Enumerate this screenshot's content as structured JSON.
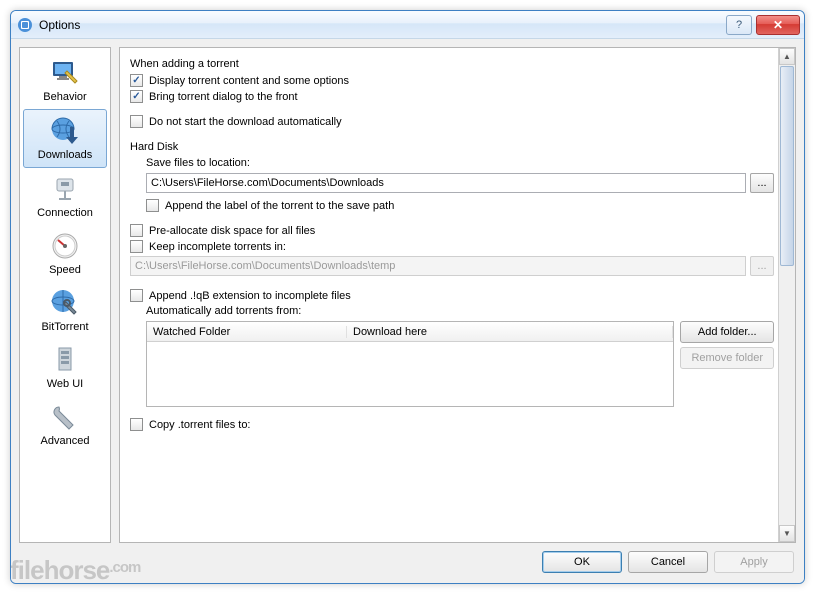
{
  "window": {
    "title": "Options",
    "help_symbol": "?",
    "close_symbol": "✕"
  },
  "sidebar": {
    "items": [
      {
        "label": "Behavior",
        "icon": "monitor-wrench-icon",
        "selected": false
      },
      {
        "label": "Downloads",
        "icon": "globe-download-icon",
        "selected": true
      },
      {
        "label": "Connection",
        "icon": "network-plug-icon",
        "selected": false
      },
      {
        "label": "Speed",
        "icon": "gauge-icon",
        "selected": false
      },
      {
        "label": "BitTorrent",
        "icon": "globe-wrench-icon",
        "selected": false
      },
      {
        "label": "Web UI",
        "icon": "server-rack-icon",
        "selected": false
      },
      {
        "label": "Advanced",
        "icon": "wrench-icon",
        "selected": false
      }
    ]
  },
  "content": {
    "group_add": {
      "header": "When adding a torrent",
      "display_content": {
        "label": "Display torrent content and some options",
        "checked": true
      },
      "bring_front": {
        "label": "Bring torrent dialog to the front",
        "checked": true
      }
    },
    "do_not_start": {
      "label": "Do not start the download automatically",
      "checked": false
    },
    "group_disk": {
      "header": "Hard Disk",
      "save_location_label": "Save files to location:",
      "save_location_value": "C:\\Users\\FileHorse.com\\Documents\\Downloads",
      "browse_label": "...",
      "append_label_path": {
        "label": "Append the label of the torrent to the save path",
        "checked": false
      }
    },
    "preallocate": {
      "label": "Pre-allocate disk space for all files",
      "checked": false
    },
    "keep_incomplete": {
      "label": "Keep incomplete torrents in:",
      "checked": false,
      "path": "C:\\Users\\FileHorse.com\\Documents\\Downloads\\temp",
      "browse_label": "..."
    },
    "append_qb": {
      "label": "Append .!qB extension to incomplete files",
      "checked": false
    },
    "auto_add": {
      "header": "Automatically add torrents from:",
      "col1": "Watched Folder",
      "col2": "Download here",
      "add_btn": "Add folder...",
      "remove_btn": "Remove folder"
    },
    "copy_torrent": {
      "label": "Copy .torrent files to:",
      "checked": false
    }
  },
  "footer": {
    "ok": "OK",
    "cancel": "Cancel",
    "apply": "Apply"
  },
  "watermark": {
    "brand": "filehorse",
    "tld": ".com"
  }
}
